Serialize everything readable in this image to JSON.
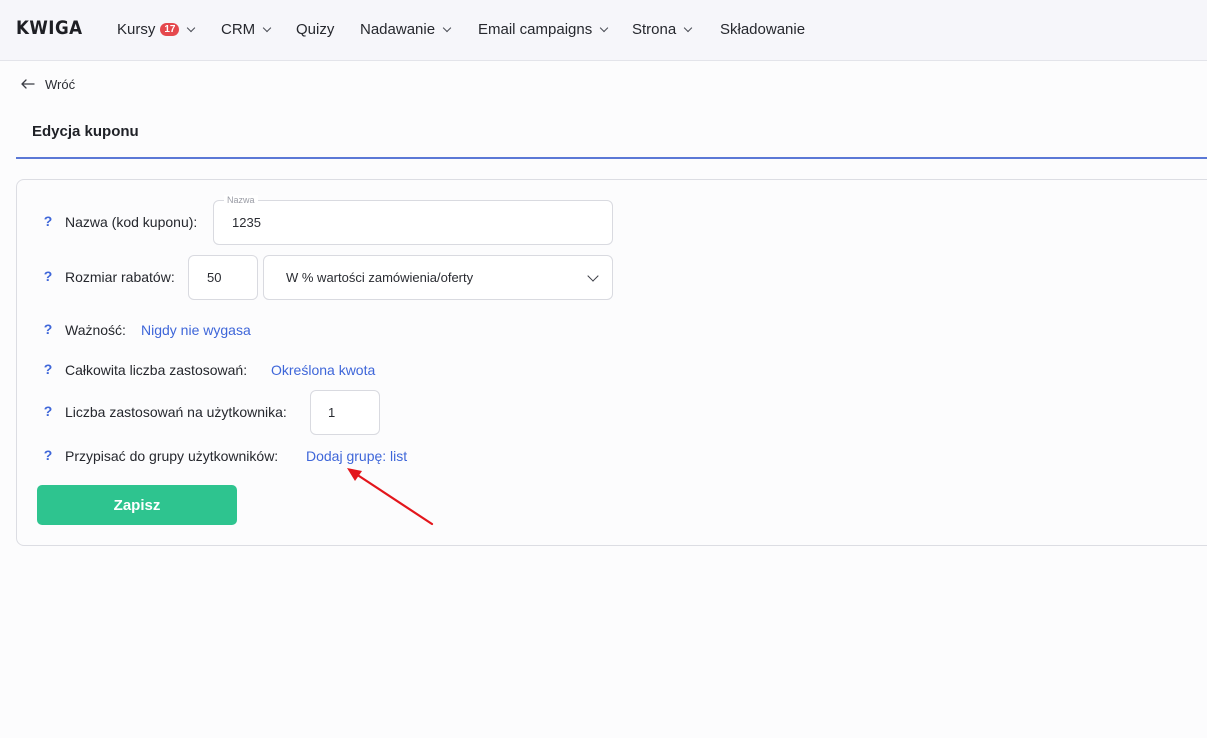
{
  "brand": {
    "logo": "KWIGA"
  },
  "nav": {
    "items": [
      {
        "label": "Kursy",
        "badge": "17",
        "has_dropdown": true
      },
      {
        "label": "CRM",
        "has_dropdown": true
      },
      {
        "label": "Quizy",
        "has_dropdown": false
      },
      {
        "label": "Nadawanie",
        "has_dropdown": true
      },
      {
        "label": "Email campaigns",
        "has_dropdown": true
      },
      {
        "label": "Strona",
        "has_dropdown": true
      },
      {
        "label": "Składowanie",
        "has_dropdown": false
      }
    ]
  },
  "back": {
    "label": "Wróć"
  },
  "page": {
    "title": "Edycja kuponu"
  },
  "form": {
    "help_icon": "?",
    "name": {
      "label": "Nazwa (kod kuponu):",
      "field_label": "Nazwa",
      "value": "1235"
    },
    "discount": {
      "label": "Rozmiar rabatów:",
      "value": "50",
      "type_selected": "W % wartości zamówienia/oferty"
    },
    "validity": {
      "label": "Ważność:",
      "value": "Nigdy nie wygasa"
    },
    "total_uses": {
      "label": "Całkowita liczba zastosowań:",
      "value": "Określona kwota"
    },
    "uses_per_user": {
      "label": "Liczba zastosowań na użytkownika:",
      "value": "1"
    },
    "user_group": {
      "label": "Przypisać do grupy użytkowników:",
      "value": "Dodaj grupę: list"
    },
    "save_label": "Zapisz"
  },
  "colors": {
    "accent_blue": "#3e66d9",
    "save_green": "#2ec48f",
    "badge_red": "#e5484d",
    "annotation_arrow": "#e3161c"
  },
  "icons": {
    "back": "arrow-left-icon",
    "dropdown": "chevron-down-icon",
    "help": "question-mark-icon",
    "annotation": "red-arrow-annotation"
  }
}
